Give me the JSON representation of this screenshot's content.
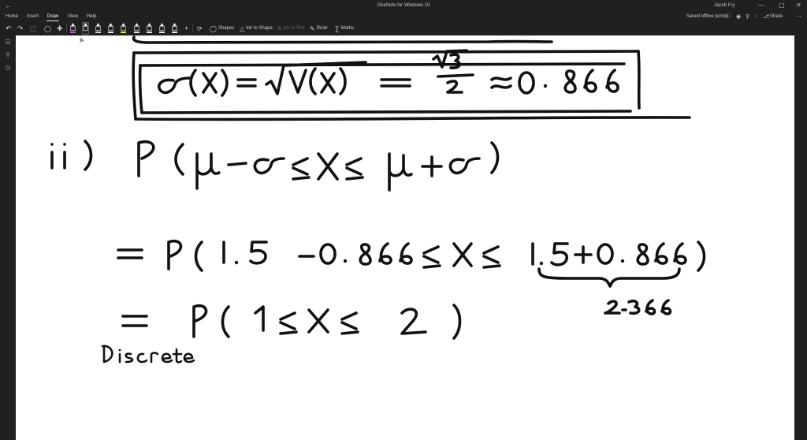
{
  "window": {
    "title": "OneNote for Windows 10",
    "user": "Jacob Fry",
    "back_icon": "arrow-left-icon",
    "min_glyph": "—",
    "max_glyph": "▢",
    "close_glyph": "✕"
  },
  "menu": {
    "tabs": [
      {
        "label": "Home"
      },
      {
        "label": "Insert"
      },
      {
        "label": "Draw",
        "active": true
      },
      {
        "label": "View"
      },
      {
        "label": "Help"
      }
    ],
    "status": "Saved offline (error)",
    "share_label": "Share"
  },
  "toolbar": {
    "shapes_label": "Shapes",
    "ink_to_shape_label": "Ink to Shape",
    "ink_to_text_label": "Ink to Text",
    "ruler_label": "Ruler",
    "maths_label": "Maths",
    "pen_colors": [
      "#d946ef",
      "#1a1a1a",
      "#d0d0d0",
      "#e6e6e6",
      "#f2f200",
      "#e6e6e6",
      "#e6e6e6",
      "#e6e6e6",
      "#e6e6e6",
      "#e6e6e6"
    ]
  },
  "colors": {
    "chrome": "#202020",
    "canvas": "#ffffff",
    "ink": "#111111"
  }
}
